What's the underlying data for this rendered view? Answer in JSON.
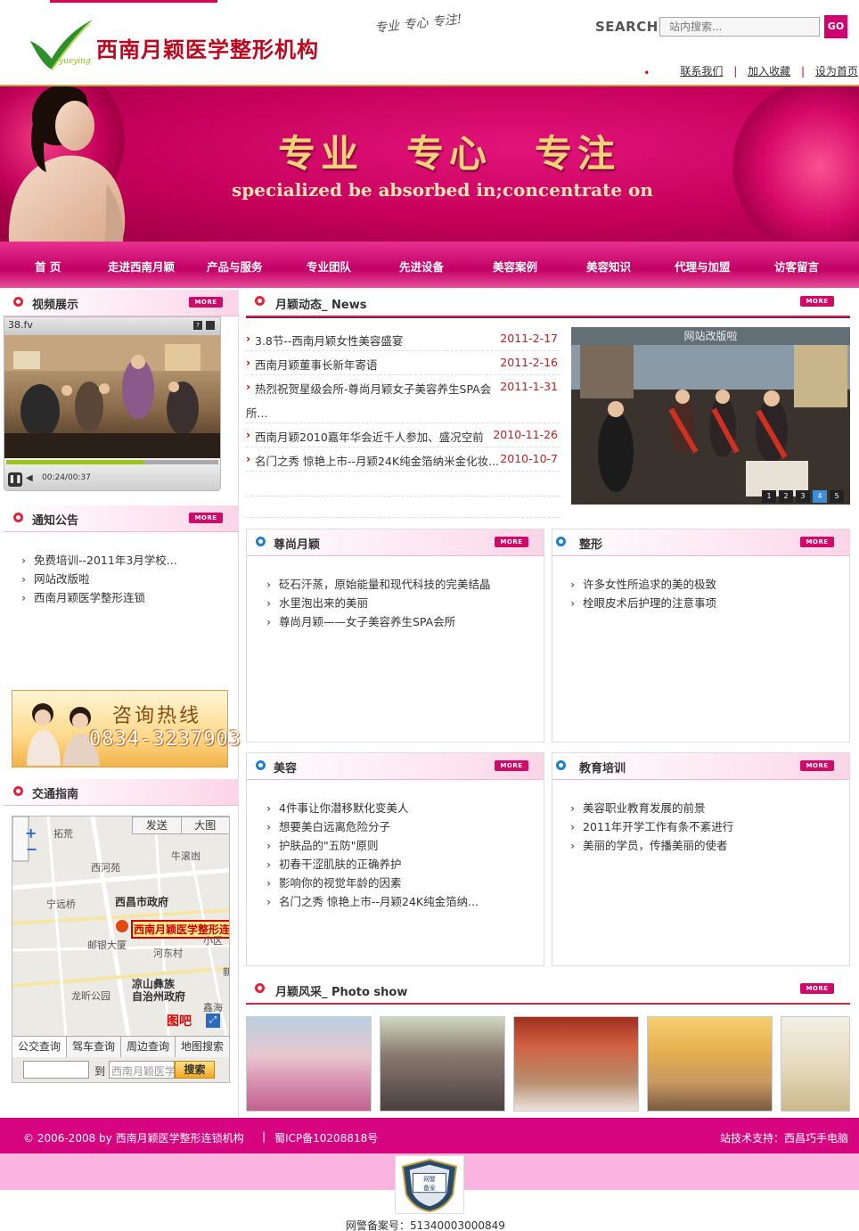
{
  "header": {
    "logo_en": "yueying",
    "logo_cn": "西南月颖医学整形机构",
    "slogan_sign": "专业 专心 专注!",
    "search_label": "SEARCH",
    "search_placeholder": "站内搜索...",
    "search_button": "GO",
    "links": [
      "联系我们",
      "加入收藏",
      "设为首页"
    ]
  },
  "banner": {
    "title_cn": "专业　专心　专注",
    "title_en": "specialized  be absorbed in;concentrate on"
  },
  "nav": {
    "items": [
      "首 页",
      "走进西南月颖",
      "产品与服务",
      "专业团队",
      "先进设备",
      "美容案例",
      "美容知识",
      "代理与加盟",
      "访客留言"
    ]
  },
  "video": {
    "title": "视频展示",
    "file": "38.fv",
    "time": "00:24/00:37",
    "more": "MORE"
  },
  "notice": {
    "title": "通知公告",
    "more": "MORE",
    "items": [
      "免费培训--2011年3月学校...",
      "网站改版啦",
      "西南月颖医学整形连锁"
    ]
  },
  "hotline": {
    "title": "咨询热线",
    "number": "0834-3237903"
  },
  "traffic": {
    "title": "交通指南",
    "more": "MORE",
    "map_buttons": [
      "发送",
      "大图"
    ],
    "map_places": [
      "拓荒",
      "西河苑",
      "牛滚凼",
      "宁远桥",
      "西昌市政府",
      "西南月颖医学整形连",
      "邮银大厦",
      "小区",
      "河东村",
      "凉山彝族",
      "自治州政府",
      "龙昕公园",
      "鑫海",
      "新"
    ],
    "map_logo": "图吧",
    "tabs": [
      "公交查询",
      "驾车查询",
      "周边查询",
      "地图搜索"
    ],
    "to_label": "到",
    "to_value": "西南月颖医学",
    "search_button": "搜索"
  },
  "news": {
    "title": "月颖动态_ News",
    "more": "MORE",
    "items": [
      {
        "title": "3.8节--西南月颖女性美容盛宴",
        "date": "2011-2-17"
      },
      {
        "title": "西南月颖董事长新年寄语",
        "date": "2011-2-16"
      },
      {
        "title": "热烈祝贺星级会所-尊尚月颖女子美容养生SPA会",
        "date": "2011-1-31"
      },
      {
        "title": "所...",
        "date": ""
      },
      {
        "title": "西南月颖2010嘉年华会近千人参加、盛况空前",
        "date": "2010-11-26"
      },
      {
        "title": "名门之秀 惊艳上市--月颖24K纯金箔纳米金化妆...",
        "date": "2010-10-7"
      }
    ],
    "slide_caption": "网站改版啦",
    "slide_dots": [
      "1",
      "2",
      "3",
      "4",
      "5"
    ]
  },
  "panels": {
    "zunshang": {
      "title": "尊尚月颖",
      "more": "MORE",
      "items": [
        "砭石汗蒸，原始能量和现代科技的完美结晶",
        "水里泡出来的美丽",
        "尊尚月颖——女子美容养生SPA会所"
      ]
    },
    "zhengxing": {
      "title": "整形",
      "more": "MORE",
      "items": [
        "许多女性所追求的美的极致",
        "栓眼皮术后护理的注意事项"
      ]
    },
    "meirong": {
      "title": "美容",
      "more": "MORE",
      "items": [
        "4件事让你潜移默化变美人",
        "想要美白远离危险分子",
        "护肤品的\"五防\"原则",
        "初春干涩肌肤的正确养护",
        "影响你的视觉年龄的因素",
        "名门之秀 惊艳上市--月颖24K纯金箔纳..."
      ]
    },
    "jiaoyu": {
      "title": "教育培训",
      "more": "MORE",
      "items": [
        "美容职业教育发展的前景",
        "2011年开学工作有条不紊进行",
        "美丽的学员，传播美丽的使者"
      ]
    }
  },
  "photos": {
    "title": "月颖风采_ Photo show",
    "more": "MORE"
  },
  "footer": {
    "copyright": "© 2006-2008 by 西南月颖医学整形连锁机构",
    "icp": "蜀ICP备10208818号",
    "support": "站技术支持：西昌巧手电脑",
    "badge_text": "网警备案",
    "beian": "网警备案号：51340003000849"
  }
}
